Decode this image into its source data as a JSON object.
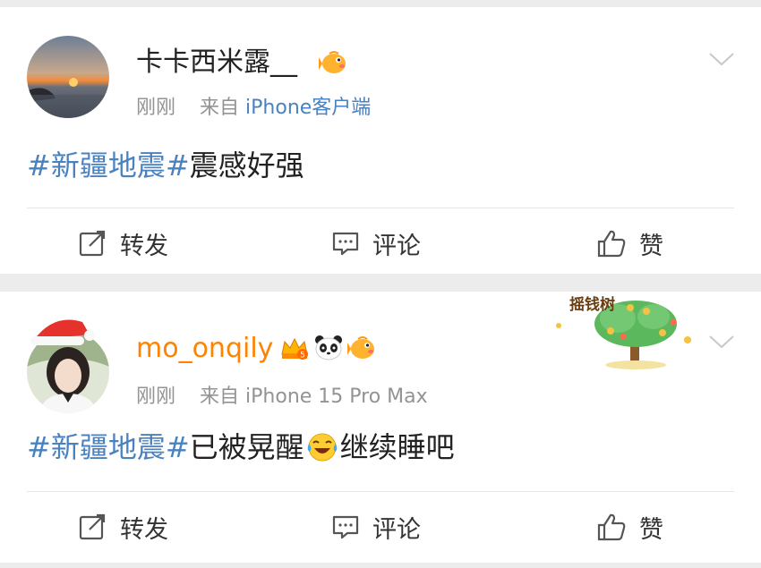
{
  "posts": [
    {
      "username": "卡卡西米露__",
      "time": "刚刚",
      "source_prefix": "来自",
      "source_name": "iPhone客户端",
      "topic": "#新疆地震#",
      "text": "震感好强",
      "actions": {
        "repost": "转发",
        "comment": "评论",
        "like": "赞"
      }
    },
    {
      "username": "mo_onqily",
      "time": "刚刚",
      "source_prefix": "来自",
      "source_name": "iPhone 15 Pro Max",
      "topic": "#新疆地震#",
      "text_before": "已被晃醒",
      "text_after": "继续睡吧",
      "decoration_text": "摇钱树",
      "actions": {
        "repost": "转发",
        "comment": "评论",
        "like": "赞"
      }
    }
  ],
  "colors": {
    "link": "#4a82c0",
    "vip_username": "#ff8200",
    "meta": "#939393",
    "page_bg": "#ececec"
  },
  "icons": [
    "repost-icon",
    "comment-icon",
    "like-icon",
    "chevron-down-icon",
    "fish-badge-icon",
    "crown-badge-icon",
    "panda-badge-icon",
    "laugh-cry-emoji"
  ]
}
